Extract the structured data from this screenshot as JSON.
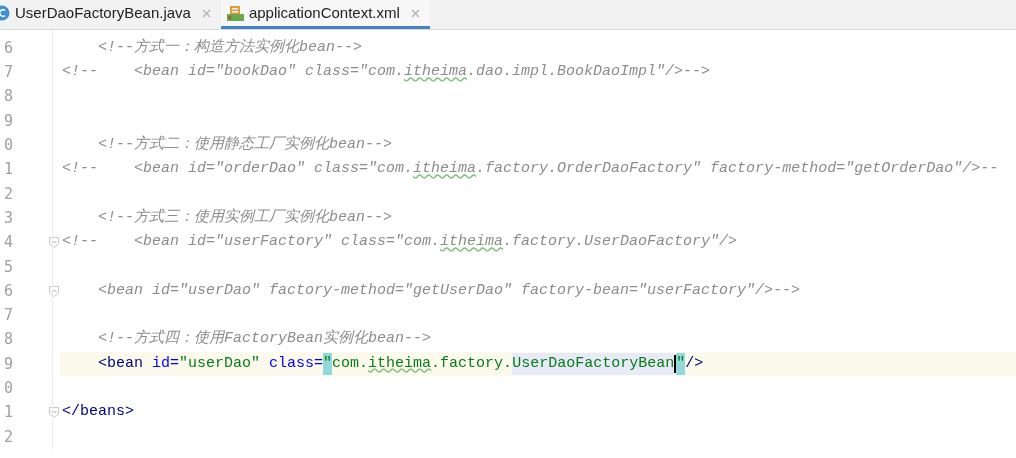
{
  "tabs": [
    {
      "label": "UserDaoFactoryBean.java",
      "kind": "java",
      "selected": false
    },
    {
      "label": "applicationContext.xml",
      "kind": "xml",
      "selected": true
    }
  ],
  "lines": [
    {
      "number": "6",
      "current": false,
      "fold_marker": false,
      "segments": [
        {
          "kind": "comment",
          "text": "    <!--方式一：构造方法实例化bean-->"
        }
      ]
    },
    {
      "number": "7",
      "current": false,
      "fold_marker": false,
      "segments": [
        {
          "kind": "comment",
          "text": "<!--    <bean id=\"bookDao\" class=\"com."
        },
        {
          "kind": "comment-typo",
          "text": "itheima"
        },
        {
          "kind": "comment",
          "text": ".dao.impl.BookDaoImpl\"/>-->"
        }
      ]
    },
    {
      "number": "8",
      "current": false,
      "fold_marker": false
    },
    {
      "number": "9",
      "current": false,
      "fold_marker": false
    },
    {
      "number": "0",
      "current": false,
      "fold_marker": false,
      "segments": [
        {
          "kind": "comment",
          "text": "    <!--方式二：使用静态工厂实例化bean-->"
        }
      ]
    },
    {
      "number": "1",
      "current": false,
      "fold_marker": false,
      "segments": [
        {
          "kind": "comment",
          "text": "<!--    <bean id=\"orderDao\" class=\"com."
        },
        {
          "kind": "comment-typo",
          "text": "itheima"
        },
        {
          "kind": "comment",
          "text": ".factory.OrderDaoFactory\" factory-method=\"getOrderDao\"/>--"
        }
      ]
    },
    {
      "number": "2",
      "current": false,
      "fold_marker": false
    },
    {
      "number": "3",
      "current": false,
      "fold_marker": false,
      "segments": [
        {
          "kind": "comment",
          "text": "    <!--方式三：使用实例工厂实例化bean-->"
        }
      ]
    },
    {
      "number": "4",
      "current": false,
      "fold_marker": true,
      "segments": [
        {
          "kind": "comment",
          "text": "<!--    <bean id=\"userFactory\" class=\"com."
        },
        {
          "kind": "comment-typo",
          "text": "itheima"
        },
        {
          "kind": "comment",
          "text": ".factory.UserDaoFactory\"/>"
        }
      ]
    },
    {
      "number": "5",
      "current": false,
      "fold_marker": false
    },
    {
      "number": "6",
      "current": false,
      "fold_marker": true,
      "segments": [
        {
          "kind": "comment",
          "text": "    <bean id=\"userDao\" factory-method=\"getUserDao\" factory-bean=\"userFactory\"/>-->"
        }
      ]
    },
    {
      "number": "7",
      "current": false,
      "fold_marker": false
    },
    {
      "number": "8",
      "current": false,
      "fold_marker": false,
      "segments": [
        {
          "kind": "comment",
          "text": "    <!--方式四：使用FactoryBean实例化bean-->"
        }
      ]
    },
    {
      "number": "9",
      "current": true,
      "fold_marker": false,
      "segments": [
        {
          "kind": "tag",
          "text": "    <bean"
        },
        {
          "kind": "attr",
          "text": " id="
        },
        {
          "kind": "value",
          "text": "\"userDao\""
        },
        {
          "kind": "attr",
          "text": " class="
        },
        {
          "kind": "brace-match",
          "text": "\""
        },
        {
          "kind": "value",
          "text": "com."
        },
        {
          "kind": "value-typo",
          "text": "itheima"
        },
        {
          "kind": "value",
          "text": ".factory."
        },
        {
          "kind": "value-mark",
          "text": "UserDaoFactoryBean",
          "caret_after": true
        },
        {
          "kind": "brace-match",
          "text": "\""
        },
        {
          "kind": "tag",
          "text": "/>"
        }
      ]
    },
    {
      "number": "0",
      "current": false,
      "fold_marker": false
    },
    {
      "number": "1",
      "current": false,
      "fold_marker": true,
      "segments": [
        {
          "kind": "tag",
          "text": "</beans>"
        }
      ]
    },
    {
      "number": "2",
      "current": false,
      "fold_marker": false
    }
  ]
}
